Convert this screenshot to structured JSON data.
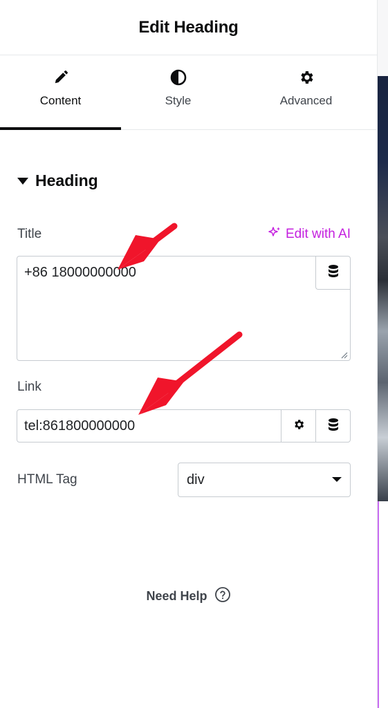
{
  "header": {
    "title": "Edit Heading"
  },
  "tabs": [
    {
      "label": "Content",
      "icon": "pencil-icon",
      "active": true
    },
    {
      "label": "Style",
      "icon": "half-circle-icon",
      "active": false
    },
    {
      "label": "Advanced",
      "icon": "gear-icon",
      "active": false
    }
  ],
  "section": {
    "title": "Heading",
    "icon": "caret-down-icon"
  },
  "title_field": {
    "label": "Title",
    "ai_label": "Edit with AI",
    "ai_icon": "sparkle-icon",
    "value": "+86 18000000000",
    "dynamic_icon": "database-icon"
  },
  "link_field": {
    "label": "Link",
    "value": "tel:861800000000",
    "settings_icon": "gear-icon",
    "dynamic_icon": "database-icon"
  },
  "html_tag": {
    "label": "HTML Tag",
    "value": "div"
  },
  "help": {
    "label": "Need Help",
    "icon": "question-circle-icon"
  },
  "colors": {
    "accent_ai": "#c41fdf",
    "annotation_arrow": "#f0152b",
    "active_tab": "#0c0d0e"
  }
}
